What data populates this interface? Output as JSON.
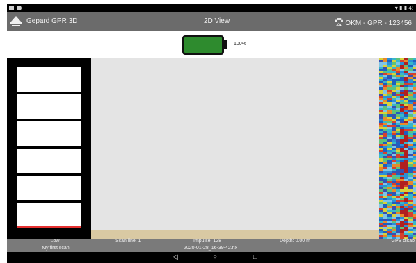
{
  "status_bar": {
    "left_icons": [
      "notification-icon",
      "dot-icon"
    ],
    "right_text": "4:"
  },
  "app_bar": {
    "app_title": "Gepard GPR 3D",
    "view_title": "2D View",
    "device_name": "OKM - GPR - 123456"
  },
  "battery": {
    "level": 100,
    "label": "100%"
  },
  "gauge": {
    "segments": 6,
    "level_indicator_color": "#e53030"
  },
  "info_bar": {
    "level": "Low",
    "scan_name": "My first scan",
    "scan_line": "Scan line: 1",
    "impulse": "Impulse: 128",
    "filename": "2020-01-28_16-39-42.nx",
    "depth": "Depth: 0.00 m",
    "gps": "GPS disab"
  },
  "nav_bar": {
    "back": "◁",
    "home": "○",
    "recents": "□"
  },
  "colors": {
    "app_bar": "#6b6b6b",
    "battery_fill": "#2e8b2e",
    "ground": "#d9c9a3",
    "gauge_bg": "#000000"
  }
}
